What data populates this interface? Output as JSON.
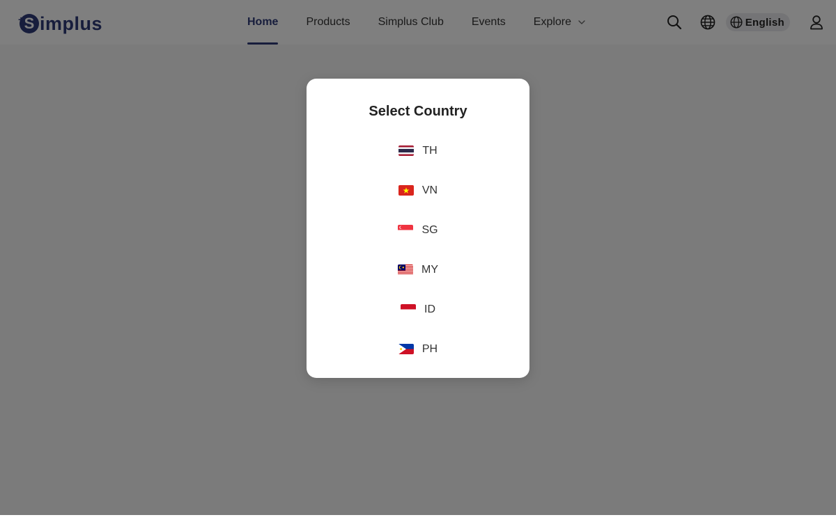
{
  "brand": {
    "logo_letter": "S",
    "logo_plus": "+",
    "logo_text": "implus"
  },
  "nav": {
    "items": [
      {
        "label": "Home",
        "active": true
      },
      {
        "label": "Products"
      },
      {
        "label": "Simplus Club"
      },
      {
        "label": "Events"
      },
      {
        "label": "Explore",
        "has_dropdown": true
      }
    ]
  },
  "toolbar": {
    "search_icon": "search-icon",
    "globe_icon": "globe-icon",
    "language_label": "English",
    "user_icon": "user-icon"
  },
  "modal": {
    "title": "Select Country",
    "countries": [
      {
        "code": "TH",
        "flag": "thailand-flag-icon"
      },
      {
        "code": "VN",
        "flag": "vietnam-flag-icon"
      },
      {
        "code": "SG",
        "flag": "singapore-flag-icon"
      },
      {
        "code": "MY",
        "flag": "malaysia-flag-icon"
      },
      {
        "code": "ID",
        "flag": "indonesia-flag-icon"
      },
      {
        "code": "PH",
        "flag": "philippines-flag-icon"
      }
    ]
  },
  "colors": {
    "brand": "#2e3a78",
    "overlay": "rgba(0,0,0,0.5)",
    "modal_bg": "#ffffff"
  }
}
